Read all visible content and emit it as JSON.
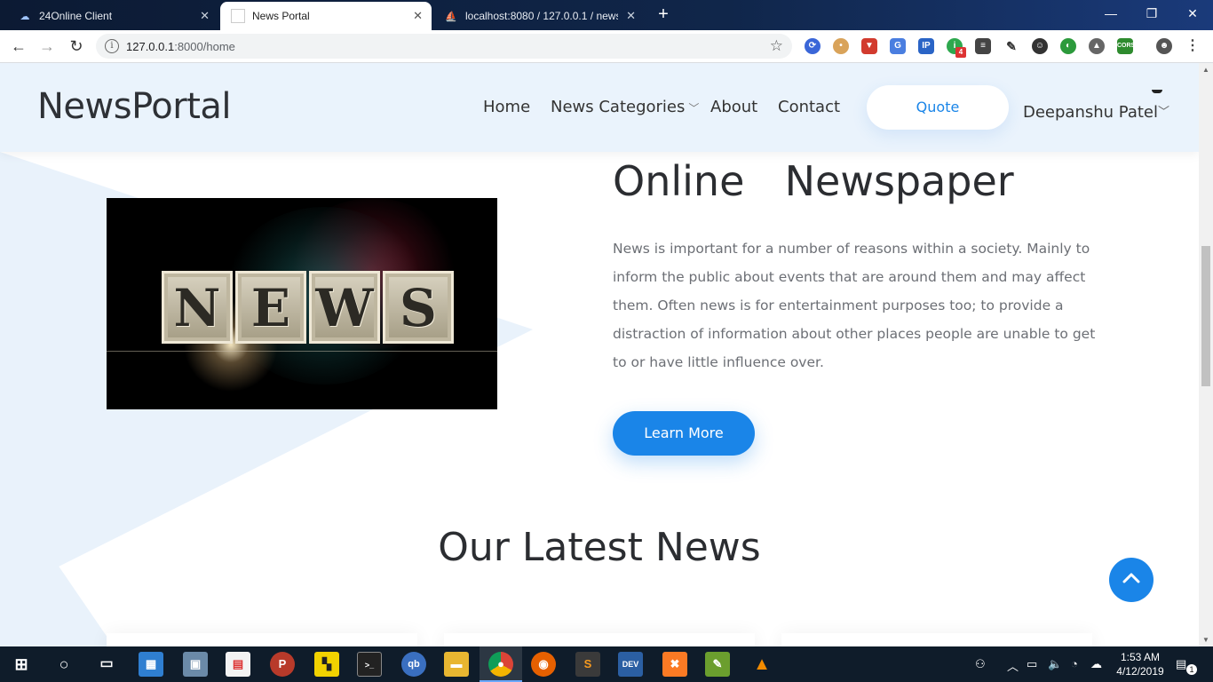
{
  "browser": {
    "tabs": [
      {
        "title": "24Online Client",
        "active": false
      },
      {
        "title": "News Portal",
        "active": true
      },
      {
        "title": "localhost:8080 / 127.0.0.1 / newsp",
        "active": false
      }
    ],
    "url_host": "127.0.0.1",
    "url_rest": ":8000/home"
  },
  "site": {
    "logo": "NewsPortal",
    "nav": {
      "home": "Home",
      "categories": "News Categories",
      "about": "About",
      "contact": "Contact"
    },
    "quote_label": "Quote",
    "user_name": "Deepanshu Patel"
  },
  "hero": {
    "image_letters": [
      "N",
      "E",
      "W",
      "S"
    ],
    "title": "Online  Newspaper",
    "text": "News is important for a number of reasons within a society. Mainly to inform the public about events that are around them and may affect them. Often news is for entertainment purposes too; to provide a distraction of information about other places people are unable to get to or have little influence over.",
    "button_label": "Learn More"
  },
  "latest": {
    "title": "Our Latest News"
  },
  "taskbar": {
    "time": "1:53 AM",
    "date": "4/12/2019",
    "notification_count": "1",
    "ext_badge": "4"
  },
  "colors": {
    "accent": "#1a85e8",
    "header_bg": "#eaf3fc"
  }
}
